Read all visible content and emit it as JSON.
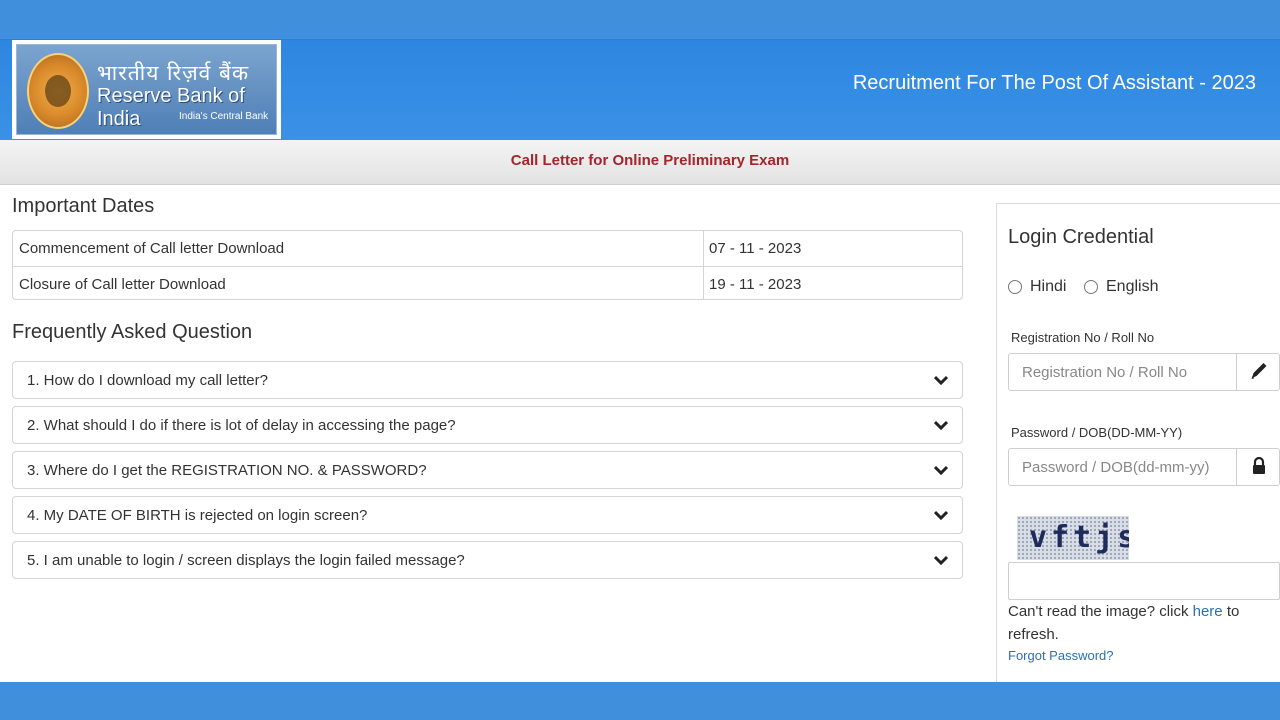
{
  "header": {
    "logo_hindi": "भारतीय रिज़र्व बैंक",
    "logo_english": "Reserve Bank of India",
    "logo_tagline": "India's Central Bank",
    "title": "Recruitment For The Post Of Assistant - 2023"
  },
  "subbar": {
    "text": "Call Letter for Online Preliminary Exam"
  },
  "important_dates": {
    "title": "Important Dates",
    "rows": [
      {
        "label": "Commencement of Call letter Download",
        "value": "07 - 11 - 2023"
      },
      {
        "label": "Closure of Call letter Download",
        "value": "19 - 11 - 2023"
      }
    ]
  },
  "faq": {
    "title": "Frequently Asked Question",
    "items": [
      "1. How do I download my call letter?",
      "2. What should I do if there is lot of delay in accessing the page?",
      "3. Where do I get the REGISTRATION NO. & PASSWORD?",
      "4. My DATE OF BIRTH is rejected on login screen?",
      "5. I am unable to login / screen displays the login failed message?"
    ]
  },
  "login": {
    "title": "Login Credential",
    "languages": [
      "Hindi",
      "English"
    ],
    "registration_label": "Registration No / Roll No",
    "registration_placeholder": "Registration No / Roll No",
    "password_label": "Password / DOB(DD-MM-YY)",
    "password_placeholder": "Password / DOB(dd-mm-yy)",
    "captcha_text": "vftjs",
    "refresh_prefix": "Can't read the image? click ",
    "refresh_link": "here",
    "refresh_suffix": " to refresh.",
    "forgot_password": "Forgot Password?"
  },
  "colors": {
    "header_blue": "#3a91e6",
    "subbar_text": "#a3262a",
    "link": "#2a6fb8"
  }
}
